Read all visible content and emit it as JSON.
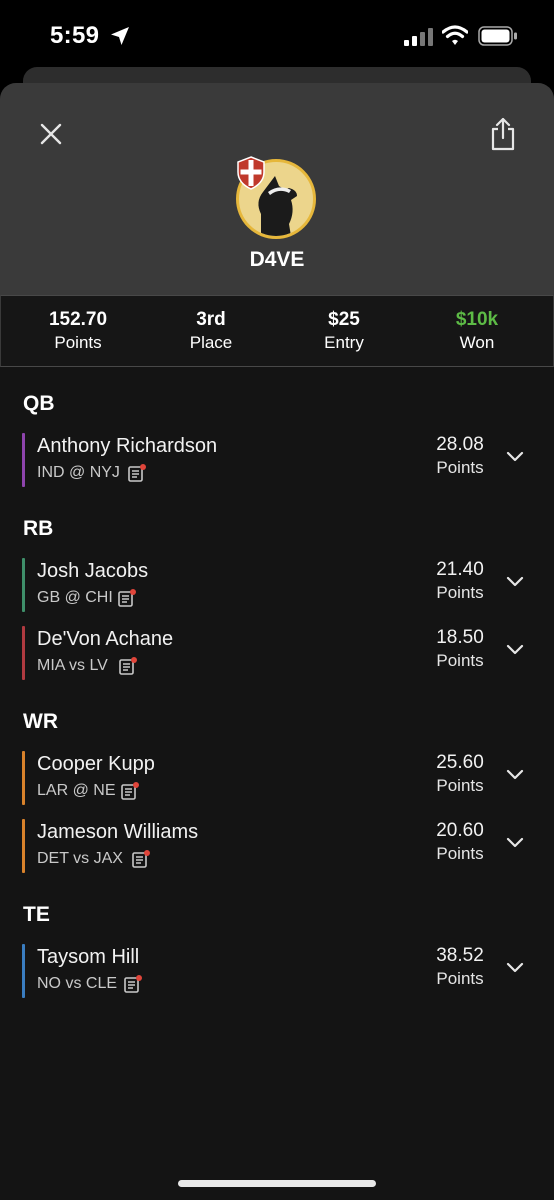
{
  "status_bar": {
    "time": "5:59"
  },
  "profile": {
    "username": "D4VE"
  },
  "stats": [
    {
      "value": "152.70",
      "label": "Points"
    },
    {
      "value": "3rd",
      "label": "Place"
    },
    {
      "value": "$25",
      "label": "Entry"
    },
    {
      "value": "$10k",
      "label": "Won",
      "color": "#5dbb46"
    }
  ],
  "sections": [
    {
      "position": "QB",
      "players": [
        {
          "name": "Anthony Richardson",
          "game": "IND @ NYJ",
          "points": "28.08",
          "unit": "Points",
          "color": "#8e44ad"
        }
      ]
    },
    {
      "position": "RB",
      "players": [
        {
          "name": "Josh Jacobs",
          "game": "GB @ CHI",
          "points": "21.40",
          "unit": "Points",
          "color": "#3f8f6a"
        },
        {
          "name": "De'Von Achane",
          "game": "MIA vs LV",
          "points": "18.50",
          "unit": "Points",
          "color": "#b03a40"
        }
      ]
    },
    {
      "position": "WR",
      "players": [
        {
          "name": "Cooper Kupp",
          "game": "LAR @ NE",
          "points": "25.60",
          "unit": "Points",
          "color": "#d9822b"
        },
        {
          "name": "Jameson Williams",
          "game": "DET vs JAX",
          "points": "20.60",
          "unit": "Points",
          "color": "#d9822b"
        }
      ]
    },
    {
      "position": "TE",
      "players": [
        {
          "name": "Taysom Hill",
          "game": "NO vs CLE",
          "points": "38.52",
          "unit": "Points",
          "color": "#3a7dc0"
        }
      ]
    }
  ],
  "icons": {
    "close": "close-icon",
    "share": "share-icon",
    "news": "news-icon",
    "expand": "chevron-down-icon",
    "alert_dot": "#e0453a"
  }
}
